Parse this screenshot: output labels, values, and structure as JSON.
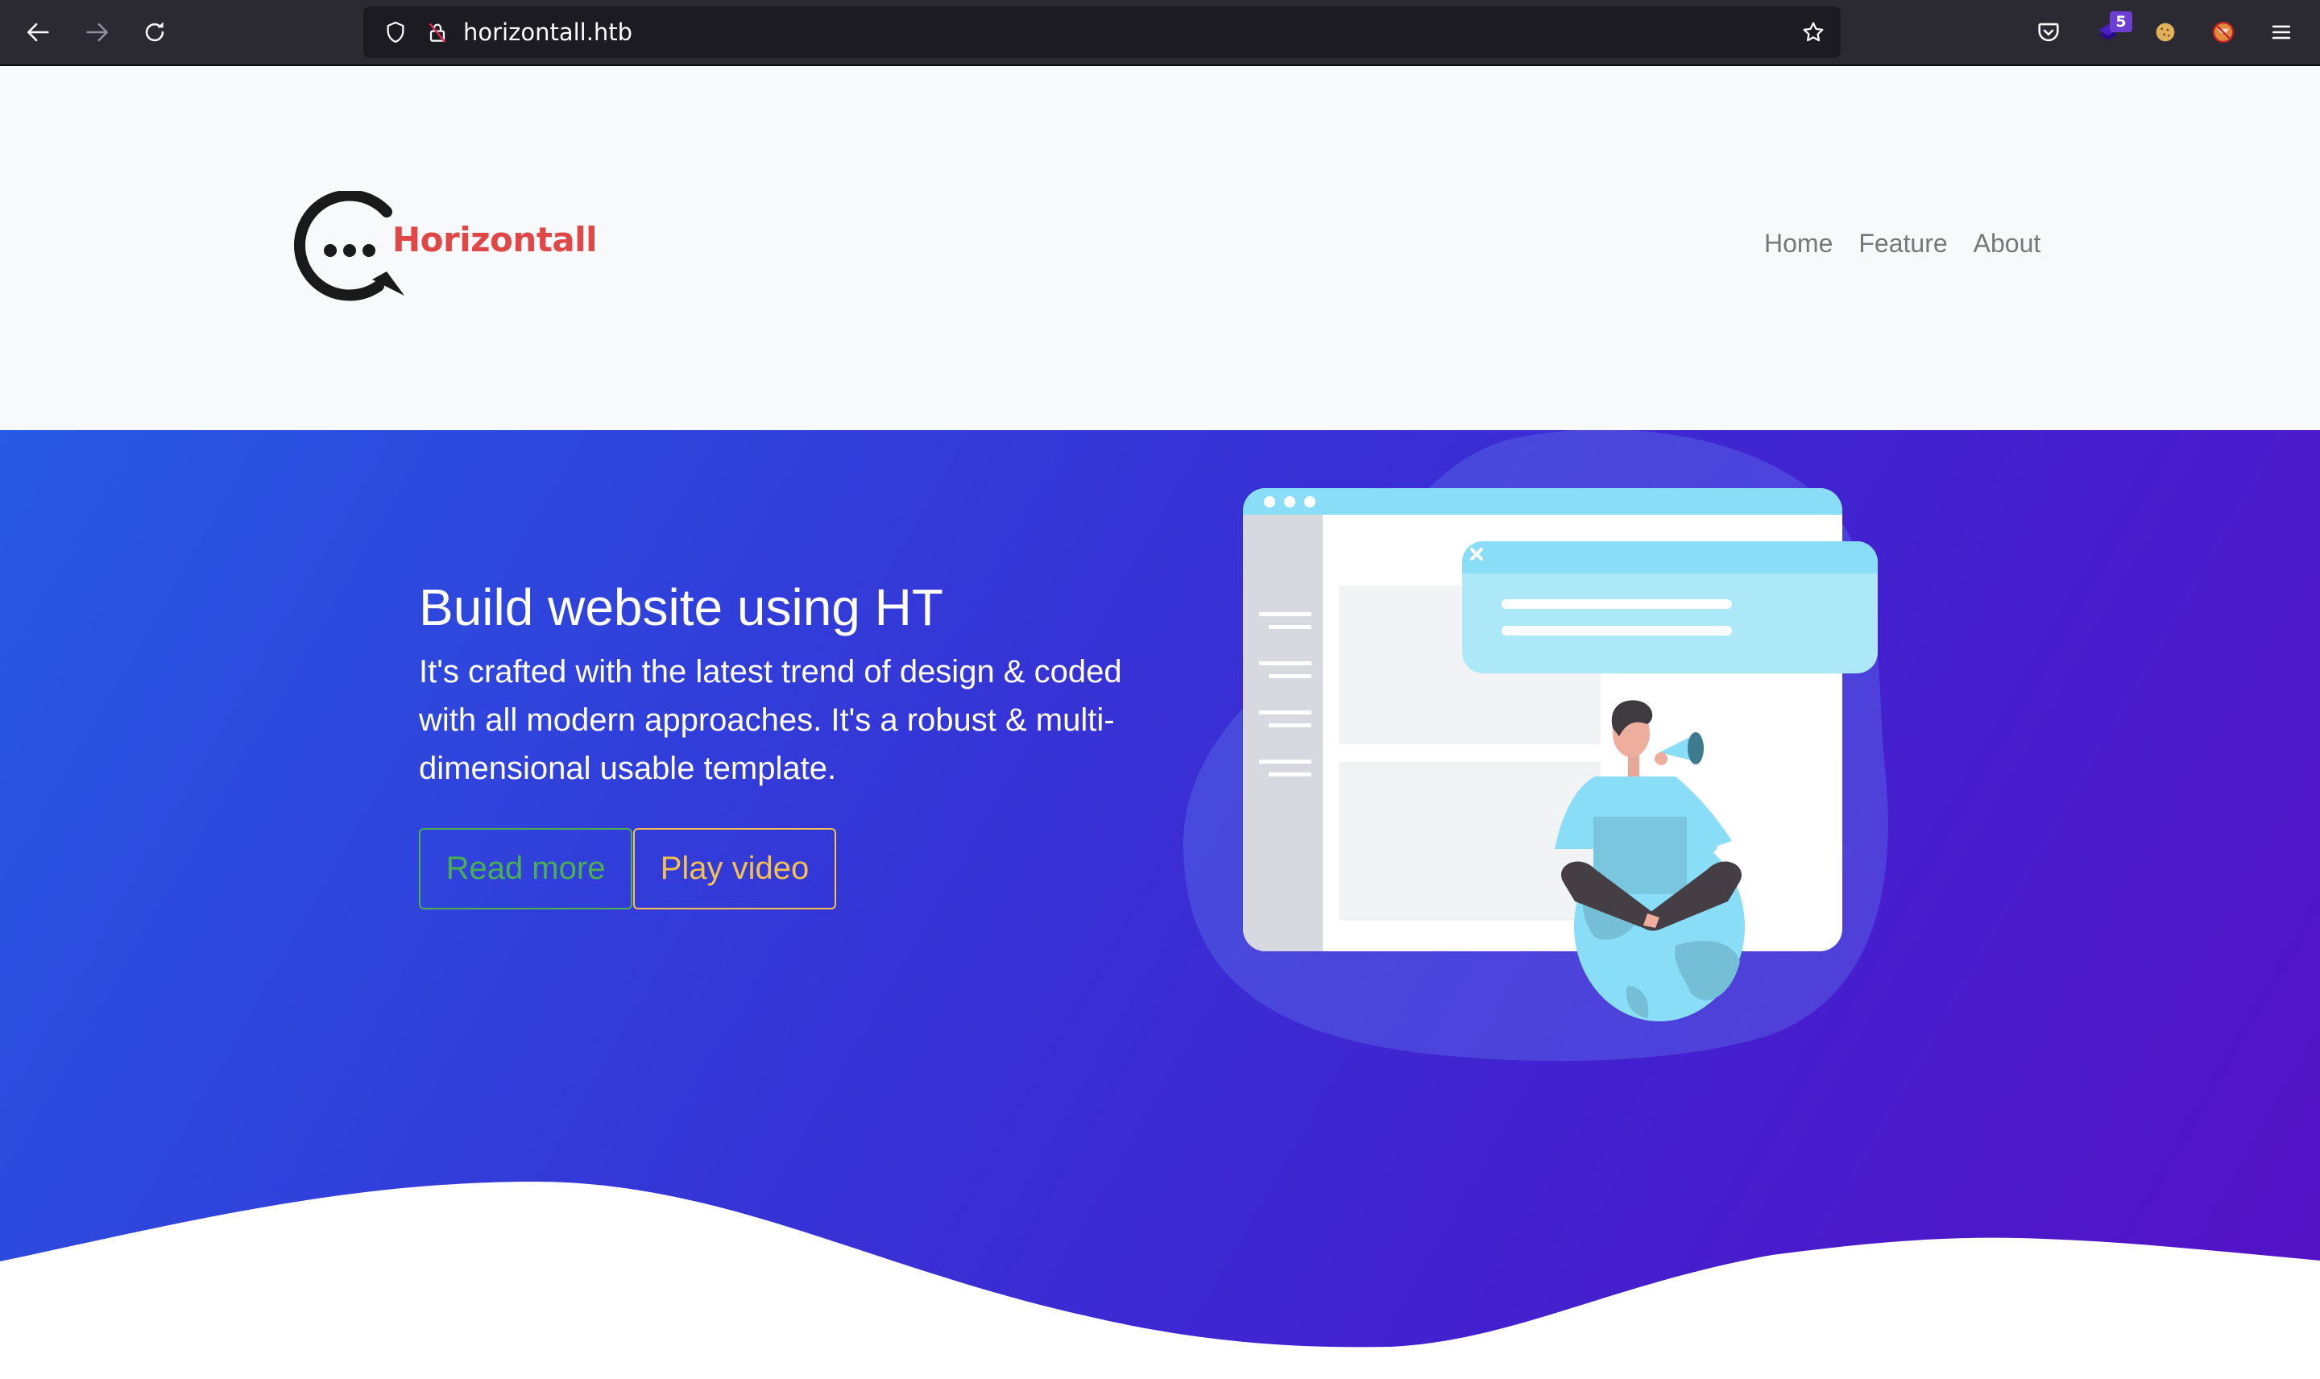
{
  "browser": {
    "url": "horizontall.htb",
    "nav_buttons": [
      {
        "name": "back",
        "icon": "arrow-left-icon"
      },
      {
        "name": "forward",
        "icon": "arrow-right-icon",
        "disabled": true
      },
      {
        "name": "reload",
        "icon": "reload-icon"
      }
    ],
    "url_icons": [
      "shield-icon",
      "insecure-lock-icon"
    ],
    "bookmark_icon": "star-icon",
    "extensions": [
      {
        "name": "pocket",
        "icon": "pocket-icon"
      },
      {
        "name": "layers-extension",
        "icon": "layers-icon",
        "badge": "5"
      },
      {
        "name": "cookie-editor",
        "icon": "cookie-icon"
      },
      {
        "name": "foxyproxy",
        "icon": "foxyproxy-disabled-icon"
      }
    ],
    "menu_icon": "hamburger-menu-icon"
  },
  "site": {
    "logo_text": "Horizontall",
    "nav": [
      {
        "label": "Home"
      },
      {
        "label": "Feature"
      },
      {
        "label": "About"
      }
    ]
  },
  "hero": {
    "title": "Build website using HT",
    "text": "It's crafted with the latest trend of design & coded with all modern approaches. It's a robust & multi-dimensional usable template.",
    "buttons": {
      "read_more": "Read more",
      "play_video": "Play video"
    },
    "colors": {
      "gradient_start": "#2759e3",
      "gradient_end": "#5512c4",
      "read_more": "#4caf50",
      "play_video": "#f4c150",
      "logo": "#e04848"
    }
  }
}
